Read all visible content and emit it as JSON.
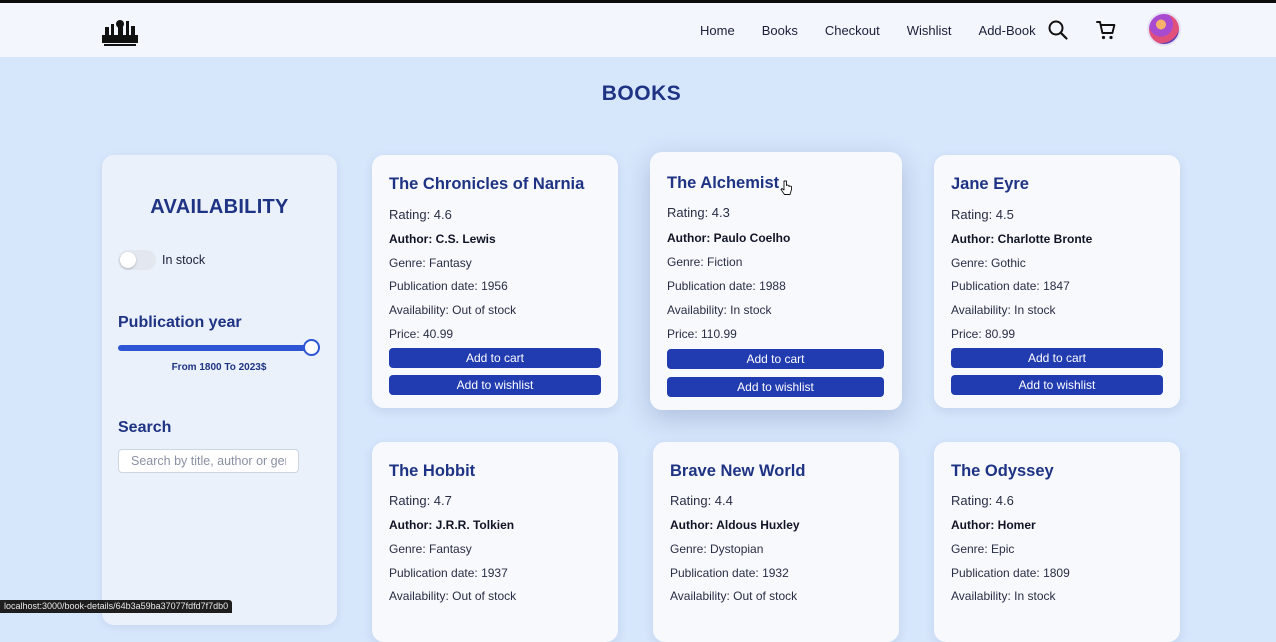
{
  "navbar": {
    "links": [
      {
        "label": "Home"
      },
      {
        "label": "Books"
      },
      {
        "label": "Checkout"
      },
      {
        "label": "Wishlist"
      },
      {
        "label": "Add-Book"
      }
    ],
    "icons": [
      "search-icon",
      "cart-icon"
    ],
    "logo": "bookshop-logo"
  },
  "page": {
    "title": "BOOKS"
  },
  "sidebar": {
    "availability_heading": "AVAILABILITY",
    "in_stock_label": "In stock",
    "in_stock_checked": false,
    "publication_heading": "Publication year",
    "range_text": "From 1800 To 2023$",
    "slider_value": 2023,
    "slider_min": 1800,
    "slider_max": 2023,
    "search_heading": "Search",
    "search_placeholder": "Search by title, author or genre",
    "search_value": ""
  },
  "books": [
    {
      "title": "The Chronicles of Narnia",
      "rating": "Rating: 4.6",
      "author": "Author: C.S. Lewis",
      "genre": "Genre: Fantasy",
      "pubdate": "Publication date: 1956",
      "availability": "Availability: Out of stock",
      "price": "Price: 40.99"
    },
    {
      "title": "The Alchemist",
      "rating": "Rating: 4.3",
      "author": "Author: Paulo Coelho",
      "genre": "Genre: Fiction",
      "pubdate": "Publication date: 1988",
      "availability": "Availability: In stock",
      "price": "Price: 110.99"
    },
    {
      "title": "Jane Eyre",
      "rating": "Rating: 4.5",
      "author": "Author: Charlotte Bronte",
      "genre": "Genre: Gothic",
      "pubdate": "Publication date: 1847",
      "availability": "Availability: In stock",
      "price": "Price: 80.99"
    },
    {
      "title": "The Hobbit",
      "rating": "Rating: 4.7",
      "author": "Author: J.R.R. Tolkien",
      "genre": "Genre: Fantasy",
      "pubdate": "Publication date: 1937",
      "availability": "Availability: Out of stock",
      "price": ""
    },
    {
      "title": "Brave New World",
      "rating": "Rating: 4.4",
      "author": "Author: Aldous Huxley",
      "genre": "Genre: Dystopian",
      "pubdate": "Publication date: 1932",
      "availability": "Availability: Out of stock",
      "price": ""
    },
    {
      "title": "The Odyssey",
      "rating": "Rating: 4.6",
      "author": "Author: Homer",
      "genre": "Genre: Epic",
      "pubdate": "Publication date: 1809",
      "availability": "Availability: In stock",
      "price": ""
    }
  ],
  "buttons": {
    "add_to_cart": "Add to cart",
    "add_to_wishlist": "Add to wishlist"
  },
  "statusbar": {
    "url": "localhost:3000/book-details/64b3a59ba37077fdfd7f7db0"
  },
  "colors": {
    "background": "#d6e6fb",
    "accent": "#213bb0",
    "heading": "#1e3384",
    "card": "#f7f9fd"
  }
}
